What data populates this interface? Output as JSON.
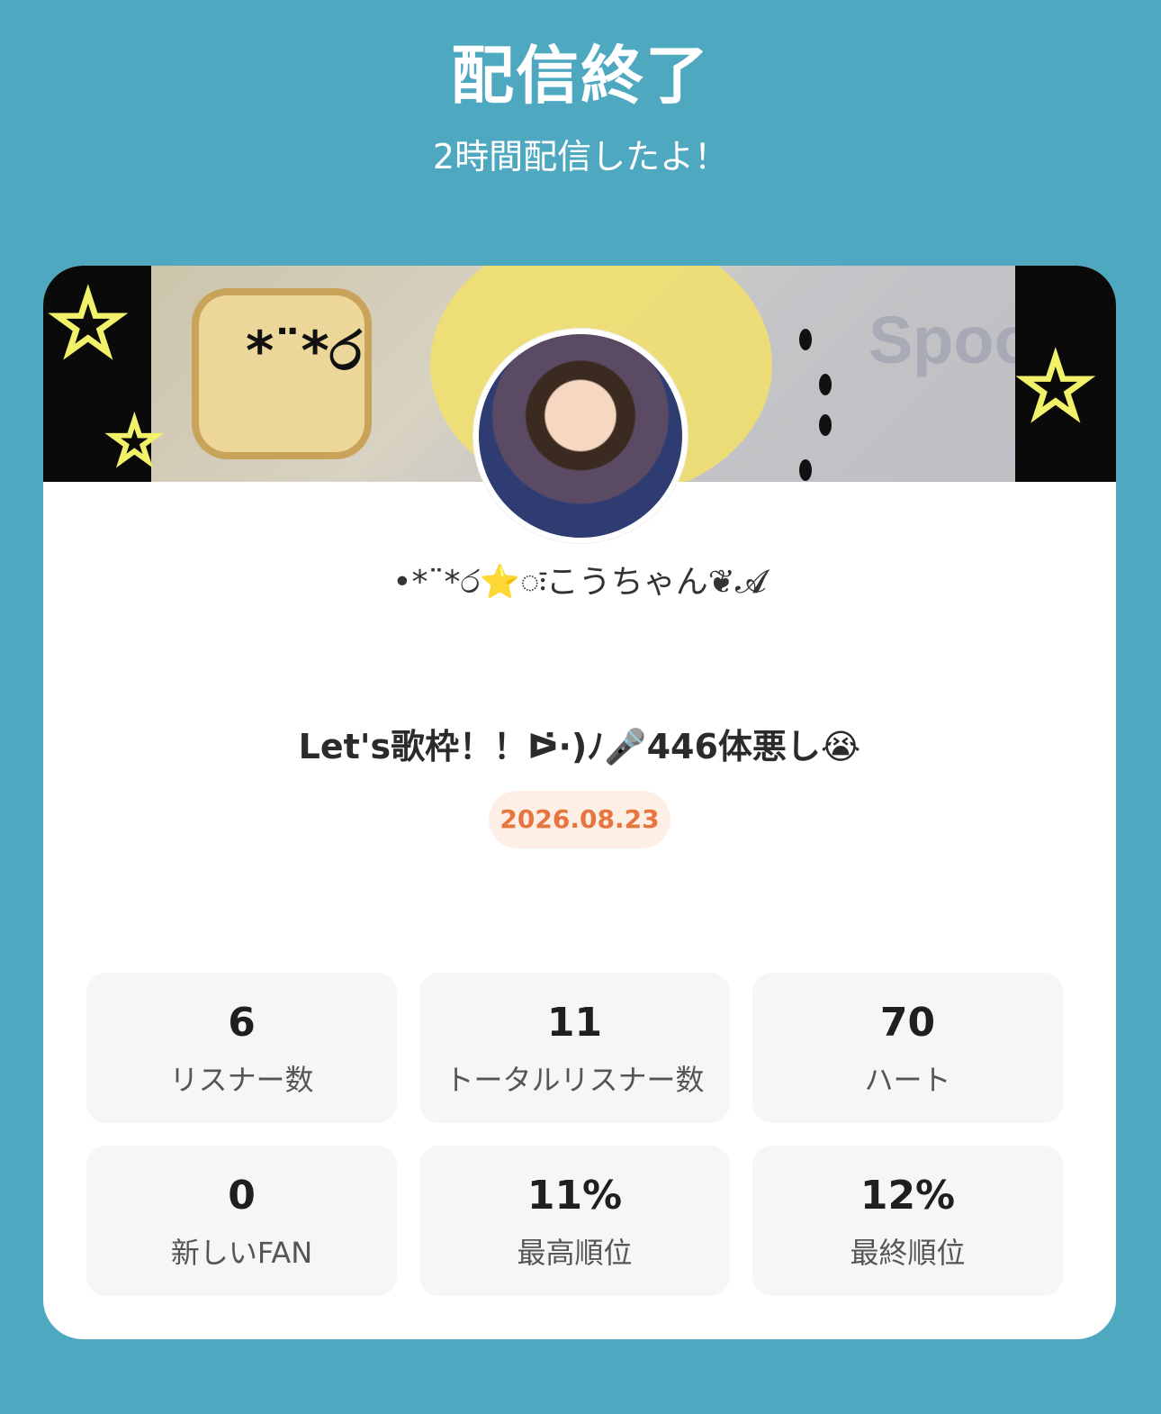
{
  "header": {
    "title": "配信終了",
    "subtitle": "2時間配信したよ！"
  },
  "banner": {
    "watermark": "Spoon",
    "face_text": "*¨*ර"
  },
  "profile": {
    "username": "•*¨*ර⭐️ःこうちゃん❦𝓐"
  },
  "live": {
    "title": "Let's歌枠！！ᐅ̇·)ﾉ🎤446体悪し😭",
    "date": "2026.08.23"
  },
  "stats": [
    {
      "value": "6",
      "label": "リスナー数"
    },
    {
      "value": "11",
      "label": "トータルリスナー数"
    },
    {
      "value": "70",
      "label": "ハート"
    },
    {
      "value": "0",
      "label": "新しいFAN"
    },
    {
      "value": "11%",
      "label": "最高順位"
    },
    {
      "value": "12%",
      "label": "最終順位"
    }
  ],
  "colors": {
    "background": "#4ea9c0",
    "date_accent": "#e7753e",
    "date_bg": "#fdeee6",
    "stat_bg": "#f6f6f6"
  }
}
